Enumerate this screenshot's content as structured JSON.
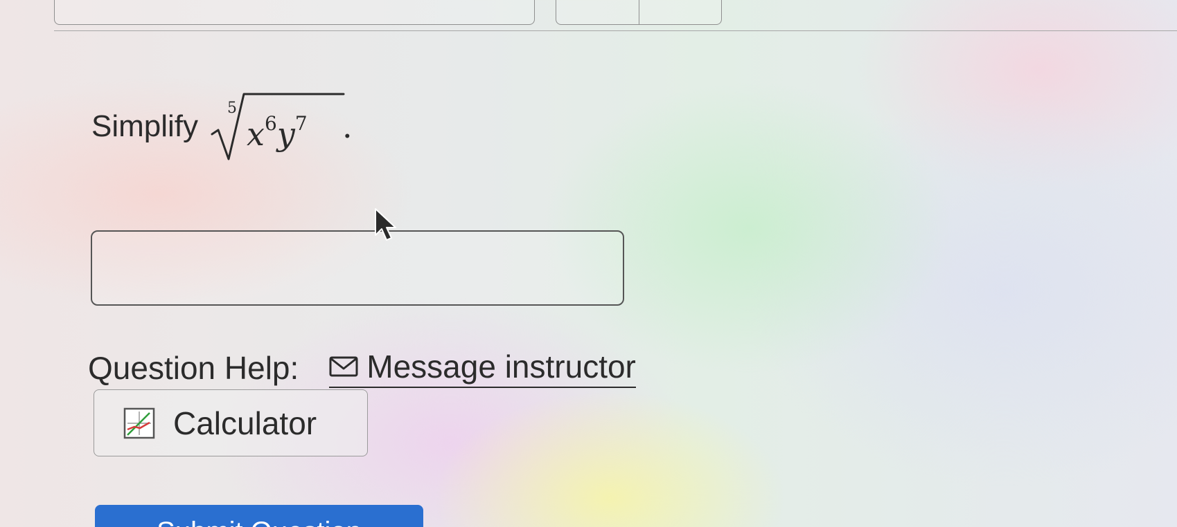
{
  "question": {
    "prompt_word": "Simplify",
    "root_index": "5",
    "radicand_base1": "x",
    "radicand_exp1": "6",
    "radicand_base2": "y",
    "radicand_exp2": "7",
    "period": "."
  },
  "answer": {
    "value": "",
    "placeholder": ""
  },
  "help": {
    "label": "Question Help:",
    "message_link": "Message instructor",
    "calculator_label": "Calculator"
  },
  "submit": {
    "label": "Submit Question"
  },
  "colors": {
    "submit_bg": "#2a6fd0",
    "text": "#2b2b2b"
  },
  "icons": {
    "message": "mail-icon",
    "calculator": "graph-calculator-icon",
    "pointer": "mouse-cursor-icon"
  }
}
